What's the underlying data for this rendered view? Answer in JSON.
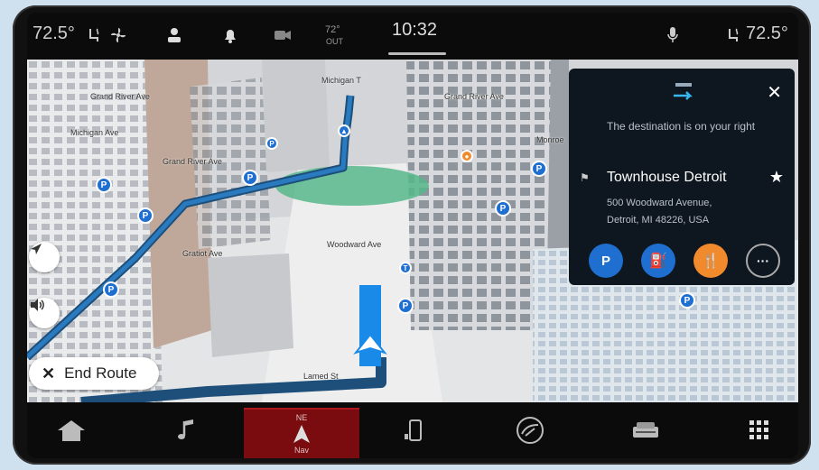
{
  "status_bar": {
    "left_temp": "72.5°",
    "clock": "10:32",
    "outside_temp": "72°",
    "outside_unit": "OUT",
    "right_temp": "72.5°",
    "icons": [
      "seat-heat-icon",
      "fan-icon",
      "profile-icon",
      "bell-icon",
      "camera-icon",
      "mic-icon",
      "seat-heat-icon"
    ]
  },
  "map": {
    "street_labels": [
      "Grand River Ave",
      "Michigan Ave",
      "Michigan T",
      "Grand River Ave",
      "Monroe",
      "Woodward Ave",
      "Gratiot Ave",
      "Grand River Ave",
      "Lamed St"
    ],
    "route_color": "#1c6fbf",
    "end_route_label": "End Route"
  },
  "destination": {
    "message": "The destination is on your right",
    "name": "Townhouse Detroit",
    "address_line1": "500 Woodward Avenue,",
    "address_line2": "Detroit, MI 48226, USA",
    "actions": [
      {
        "icon": "parking-icon",
        "color": "#1e6fd0",
        "text": "P"
      },
      {
        "icon": "fuel-icon",
        "color": "#1e6fd0",
        "text": "⛽"
      },
      {
        "icon": "restaurant-icon",
        "color": "#f08a2c",
        "text": "🍴"
      },
      {
        "icon": "more-icon",
        "color": "#0e1620",
        "text": "···"
      }
    ]
  },
  "bottom_nav": {
    "active_label": "Nav",
    "active_heading": "NE",
    "items": [
      "home-icon",
      "music-icon",
      "nav-icon",
      "phone-icon",
      "comfort-icon",
      "vehicle-icon",
      "apps-icon"
    ]
  }
}
